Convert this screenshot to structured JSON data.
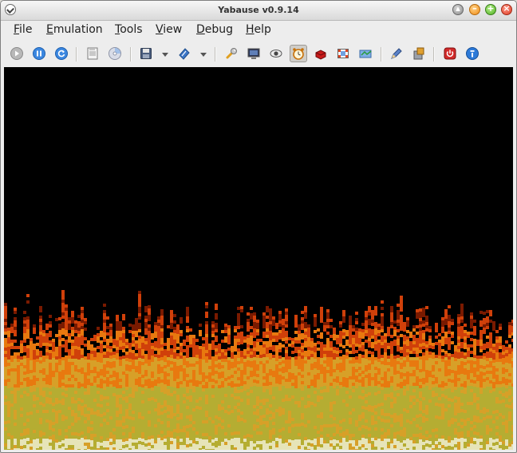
{
  "window": {
    "title": "Yabause v0.9.14"
  },
  "menubar": {
    "items": [
      {
        "mnemonic": "F",
        "rest": "ile",
        "name": "menu-file"
      },
      {
        "mnemonic": "E",
        "rest": "mulation",
        "name": "menu-emulation"
      },
      {
        "mnemonic": "T",
        "rest": "ools",
        "name": "menu-tools"
      },
      {
        "mnemonic": "V",
        "rest": "iew",
        "name": "menu-view"
      },
      {
        "mnemonic": "D",
        "rest": "ebug",
        "name": "menu-debug"
      },
      {
        "mnemonic": "H",
        "rest": "elp",
        "name": "menu-help"
      }
    ]
  },
  "toolbar": {
    "icons": [
      "play-icon",
      "pause-icon",
      "reset-icon",
      "open-iso-icon",
      "open-cd-icon",
      "save-state-icon",
      "load-state-icon",
      "settings-wrench-icon",
      "fullscreen-monitor-icon",
      "sound-eye-icon",
      "fps-alarm-clock-icon",
      "layer-toggle-icon",
      "screenshot-frame-icon",
      "transfer-icon",
      "cheats-pen-icon",
      "backup-ram-icon",
      "quit-power-icon",
      "about-info-icon"
    ],
    "active": "fps-alarm-clock-icon"
  },
  "emulator_screen": {
    "content": "fire-effect",
    "colors": {
      "background": "#000000",
      "flame_dark": "#7a1a00",
      "flame_red": "#d0400a",
      "flame_orange": "#e8790f",
      "flame_amber": "#d7a028",
      "flame_olive": "#b5ad32",
      "flame_base": "#e6e4b8"
    }
  }
}
